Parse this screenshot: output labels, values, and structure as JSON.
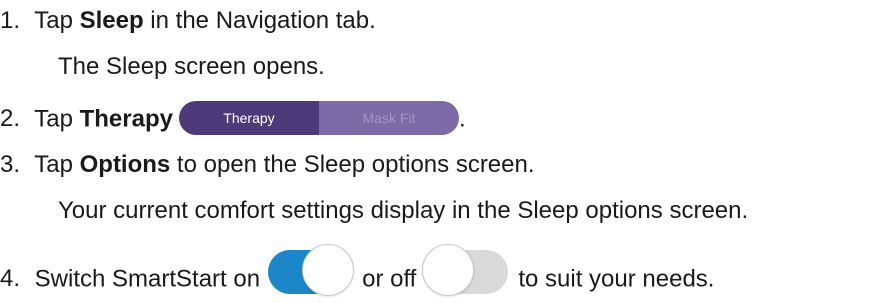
{
  "steps": [
    {
      "num": "1.",
      "pre": "Tap ",
      "bold": "Sleep",
      "post": " in the Navigation tab.",
      "result": "The Sleep screen opens."
    },
    {
      "num": "2.",
      "pre": "Tap ",
      "bold": "Therapy",
      "post": "."
    },
    {
      "num": "3.",
      "pre": "Tap ",
      "bold": "Options",
      "post": " to open the Sleep options screen.",
      "result": "Your current comfort settings display in the Sleep options screen."
    },
    {
      "num": "4.",
      "pre": "Switch SmartStart on",
      "mid": "or off",
      "post": "to suit your needs."
    }
  ],
  "segmented": {
    "left_label": "Therapy",
    "right_label": "Mask Fit",
    "active": "Therapy"
  },
  "toggles": {
    "on_color": "#1b87c9",
    "off_color": "#d9d9d9"
  }
}
